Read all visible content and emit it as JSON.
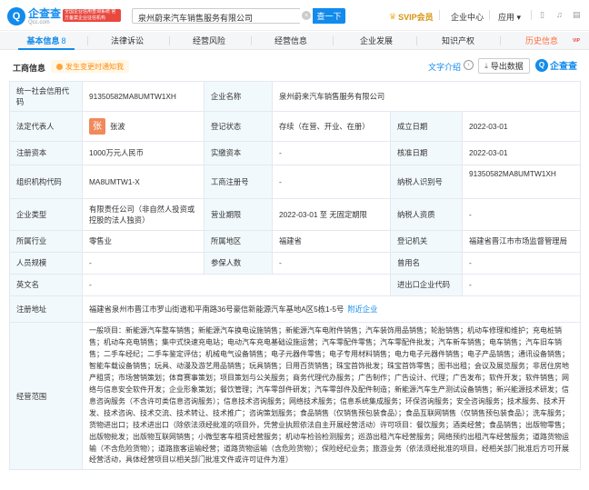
{
  "header": {
    "logo_mark": "Q",
    "logo_name": "企查查",
    "logo_domain": "Qcc.com",
    "logo_badge": "全国企业信用查询系统 官方备案企业征信机构",
    "search_value": "泉州蔚来汽车销售服务有限公司",
    "search_clear": "×",
    "search_button": "查一下",
    "svip_label": "SVIP会员",
    "enterprise_center": "企业中心",
    "apps_label": "应用",
    "apps_arrow": "▾",
    "phone_icon": "▯",
    "bell_icon": "♫",
    "doc_icon": "▤"
  },
  "tabs": [
    {
      "label": "基本信息",
      "count": "8"
    },
    {
      "label": "法律诉讼"
    },
    {
      "label": "经营风险"
    },
    {
      "label": "经营信息"
    },
    {
      "label": "企业发展"
    },
    {
      "label": "知识产权"
    },
    {
      "label": "历史信息",
      "tag": "VIP"
    }
  ],
  "section": {
    "title": "工商信息",
    "notice": "发生变更时通知我",
    "text_intro": "文字介绍",
    "intro_icon": "›",
    "export_label": "导出数据",
    "export_icon": "⤓",
    "brand_mark": "Q",
    "brand_text": "企查查"
  },
  "info": {
    "credit_code_label": "统一社会信用代码",
    "credit_code": "91350582MA8UMTW1XH",
    "company_name_label": "企业名称",
    "company_name": "泉州蔚来汽车销售服务有限公司",
    "legal_rep_label": "法定代表人",
    "legal_rep_avatar": "张",
    "legal_rep": "张波",
    "reg_status_label": "登记状态",
    "reg_status": "存续（在营、开业、在册）",
    "established_label": "成立日期",
    "established": "2022-03-01",
    "reg_capital_label": "注册资本",
    "reg_capital": "1000万元人民币",
    "paid_capital_label": "实缴资本",
    "paid_capital": "-",
    "approved_label": "核准日期",
    "approved": "2022-03-01",
    "org_code_label": "组织机构代码",
    "org_code": "MA8UMTW1-X",
    "biz_reg_no_label": "工商注册号",
    "biz_reg_no": "-",
    "tax_id_label": "纳税人识别号",
    "tax_id": "91350582MA8UMTW1XH",
    "company_type_label": "企业类型",
    "company_type": "有限责任公司（非自然人投资或控股的法人独资）",
    "biz_term_label": "营业期限",
    "biz_term": "2022-03-01 至 无固定期限",
    "taxpayer_qual_label": "纳税人资质",
    "taxpayer_qual": "-",
    "industry_label": "所属行业",
    "industry": "零售业",
    "region_label": "所属地区",
    "region": "福建省",
    "reg_authority_label": "登记机关",
    "reg_authority": "福建省晋江市市场监督管理局",
    "staff_size_label": "人员规模",
    "staff_size": "-",
    "insured_label": "参保人数",
    "insured": "-",
    "former_name_label": "曾用名",
    "former_name": "-",
    "english_name_label": "英文名",
    "english_name": "-",
    "import_export_label": "进出口企业代码",
    "import_export": "-",
    "address_label": "注册地址",
    "address": "福建省泉州市晋江市罗山街道和平南路36号豪信新能源汽车基地A区5栋1-5号",
    "address_link": "附近企业",
    "scope_label": "经营范围",
    "scope": "一般项目：新能源汽车整车销售；新能源汽车换电设施销售；新能源汽车电附件销售；汽车装饰用品销售；轮胎销售；机动车修理和维护；充电桩销售；机动车充电销售；集中式快速充电站；电动汽车充电基础设施运营；汽车零配件零售；汽车零配件批发；汽车新车销售；电车销售；汽车旧车销售；二手车经纪；二手车鉴定评估；机械电气设备销售；电子元器件零售；电子专用材料销售；电力电子元器件销售；电子产品销售；通讯设备销售；智能车载设备销售；玩具、动漫及游艺用品销售；玩具销售；日用百货销售；珠宝首饰批发；珠宝首饰零售；图书出租；会议及展览服务；非居住房地产租赁；市场营销策划；体育赛事策划；项目策划与公关服务；商务代理代办服务；广告制作；广告设计、代理；广告发布；软件开发；软件销售；网络与信息安全软件开发；企业形象策划；餐饮管理；汽车零部件研发；汽车零部件及配件制造；新能源汽车生产测试设备销售；新兴能源技术研发；信息咨询服务（不含许可类信息咨询服务）；信息技术咨询服务；网络技术服务；信息系统集成服务；环保咨询服务；安全咨询服务；技术服务、技术开发、技术咨询、技术交流、技术转让、技术推广；咨询策划服务；食品销售（仅销售预包装食品）；食品互联网销售（仅销售预包装食品）；洗车服务；货物进出口；技术进出口（除依法须经批准的项目外，凭营业执照依法自主开展经营活动）许可项目：餐饮服务；酒类经营；食品销售；出版物零售；出版物批发；出版物互联网销售；小微型客车租赁经营服务；机动车检验检测服务；巡游出租汽车经营服务；网络预约出租汽车经营服务；道路货物运输（不含危险货物）；道路旅客运输经营；道路货物运输（含危险货物）；保险经纪业务；旅游业务（依法须经批准的项目，经相关部门批准后方可开展经营活动，具体经营项目以相关部门批准文件或许可证件为准）"
  },
  "colors": {
    "brand_blue": "#128bed",
    "label_bg": "#f2f9fc",
    "history_orange": "#ff6d3a",
    "svip_gold": "#d8940f"
  }
}
